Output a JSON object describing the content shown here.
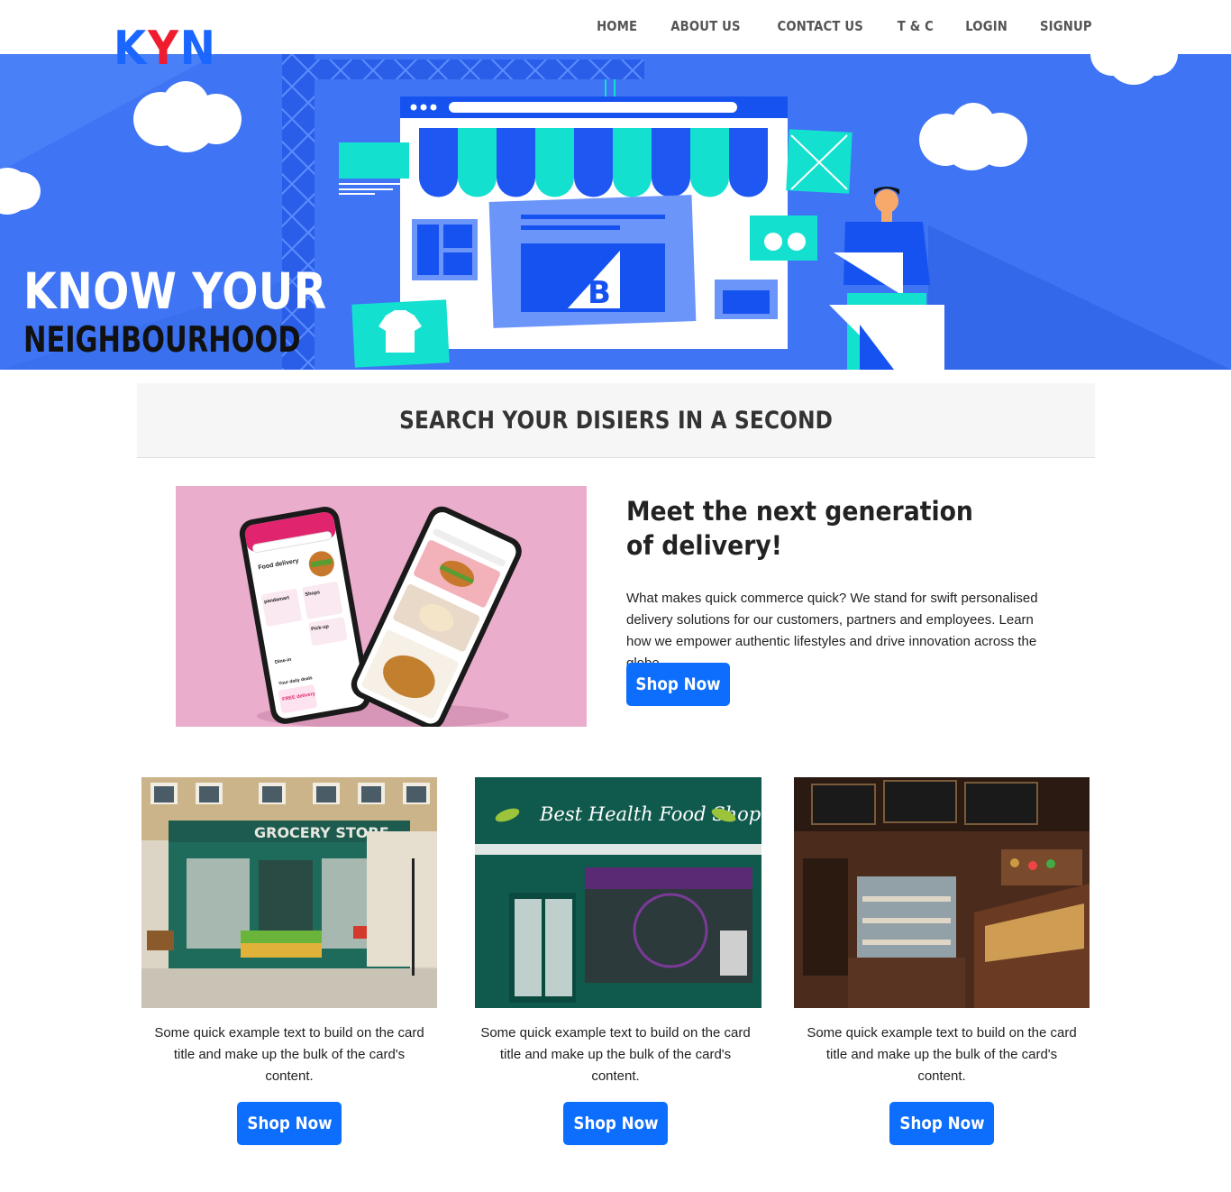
{
  "brand": {
    "letters": [
      "K",
      "Y",
      "N"
    ],
    "colors": {
      "k": "#1a66ff",
      "y": "#ee1c2e",
      "n": "#1a66ff"
    }
  },
  "nav": {
    "items": [
      "HOME",
      "ABOUT US",
      "CONTACT US",
      "T & C",
      "LOGIN",
      "SIGNUP"
    ]
  },
  "hero": {
    "title": "KNOW YOUR",
    "subtitle": "NEIGHBOURHOOD",
    "illustration_icons": [
      "cloud-icon",
      "storefront-icon",
      "tshirt-icon",
      "glasses-icon",
      "mail-icon",
      "person-icon"
    ]
  },
  "search_banner": {
    "heading": "SEARCH YOUR DISIERS IN A SECOND"
  },
  "feature": {
    "heading": "Meet the next generation of delivery!",
    "body": "What makes quick commerce quick? We stand for swift personalised delivery solutions for our customers, partners and employees. Learn how we empower authentic lifestyles and drive innovation across the globe.",
    "button": "Shop Now",
    "phone_screen_texts": [
      "Food delivery",
      "pandamart",
      "Shops",
      "Pick-up",
      "Dine-in",
      "Your daily deals",
      "FREE delivery"
    ]
  },
  "cards": [
    {
      "sign": "GROCERY STORE",
      "text": "Some quick example text to build on the card title and make up the bulk of the card's content.",
      "button": "Shop Now"
    },
    {
      "sign": "Best Health Food Shop",
      "text": "Some quick example text to build on the card title and make up the bulk of the card's content.",
      "button": "Shop Now"
    },
    {
      "sign": "",
      "text": "Some quick example text to build on the card title and make up the bulk of the card's content.",
      "button": "Shop Now"
    }
  ],
  "colors": {
    "primary": "#0d6efd",
    "hero_blue": "#3f74f4",
    "accent_teal": "#14e0d0",
    "banner_bg": "#f6f6f6"
  }
}
